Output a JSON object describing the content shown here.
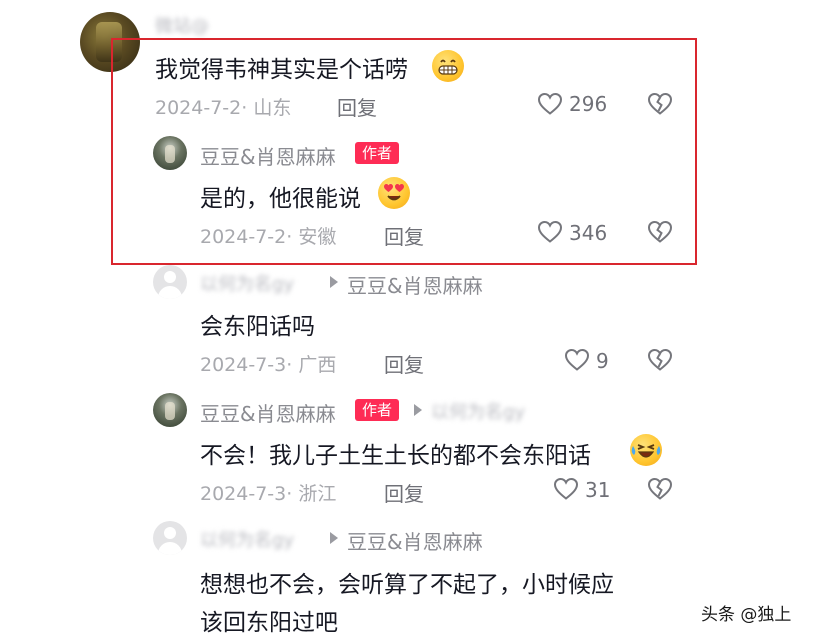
{
  "comments": {
    "top": {
      "username": "微站@",
      "text": "我觉得韦神其实是个话唠",
      "emoji": "grinning-face",
      "meta": "2024-7-2· 山东",
      "reply_label": "回复",
      "likes": "296"
    },
    "reply1": {
      "username": "豆豆&肖恩麻麻",
      "badge": "作者",
      "text": "是的，他很能说",
      "emoji": "heart-eyes-face",
      "meta": "2024-7-2· 安徽",
      "reply_label": "回复",
      "likes": "346"
    },
    "reply2": {
      "username": "以何为名gy",
      "reply_to": "豆豆&肖恩麻麻",
      "text": "会东阳话吗",
      "meta": "2024-7-3· 广西",
      "reply_label": "回复",
      "likes": "9"
    },
    "reply3": {
      "username": "豆豆&肖恩麻麻",
      "badge": "作者",
      "reply_to": "以何为名gy",
      "text": "不会！我儿子土生土长的都不会东阳话",
      "emoji": "laughing-tears-face",
      "meta": "2024-7-3· 浙江",
      "reply_label": "回复",
      "likes": "31"
    },
    "reply4": {
      "username": "以何为名gy",
      "reply_to": "豆豆&肖恩麻麻",
      "text_line1": "想想也不会，会听算了不起了，小时候应",
      "text_line2": "该回东阳过吧"
    }
  },
  "watermark": "头条 @独上",
  "colors": {
    "highlight_border": "#d9262e",
    "author_badge": "#fe2c55",
    "meta_text": "#a8a9ae",
    "username_text": "#8a8b91"
  }
}
